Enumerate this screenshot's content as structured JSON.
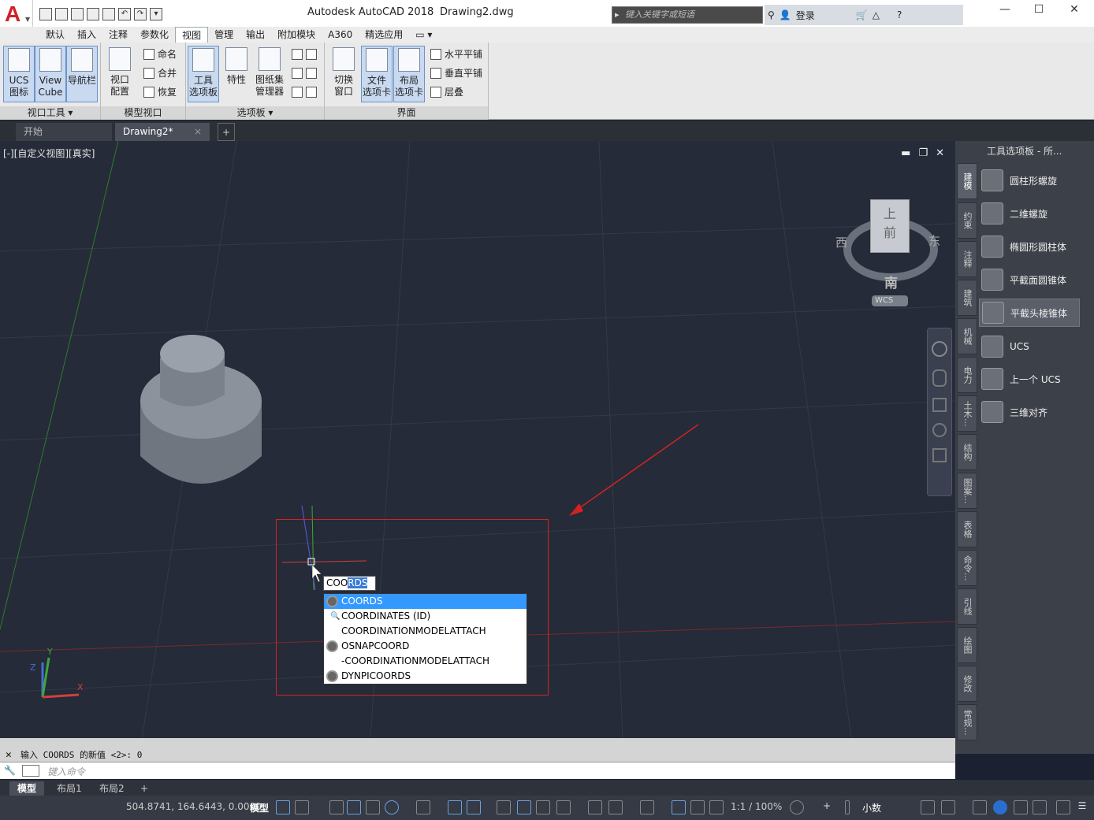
{
  "title": {
    "app": "Autodesk AutoCAD 2018",
    "doc": "Drawing2.dwg",
    "search_placeholder": "键入关键字或短语",
    "login": "登录"
  },
  "menu": [
    "默认",
    "插入",
    "注释",
    "参数化",
    "视图",
    "管理",
    "输出",
    "附加模块",
    "A360",
    "精选应用"
  ],
  "active_menu": "视图",
  "ribbon": {
    "panels": [
      "视口工具 ▾",
      "模型视口",
      "选项板 ▾",
      "界面"
    ],
    "buttons": {
      "ucs1": "UCS",
      "ucs2": "图标",
      "cube1": "View",
      "cube2": "Cube",
      "nav": "导航栏",
      "vp1": "视口",
      "vp2": "配置",
      "named": "命名",
      "join": "合并",
      "restore": "恢复",
      "tp1": "工具",
      "tp2": "选项板",
      "props": "特性",
      "ss1": "图纸集",
      "ss2": "管理器",
      "sw1": "切换",
      "sw2": "窗口",
      "ft1": "文件",
      "ft2": "选项卡",
      "lt1": "布局",
      "lt2": "选项卡",
      "tileh": "水平平铺",
      "tilev": "垂直平铺",
      "cascade": "层叠"
    }
  },
  "filetabs": [
    "开始",
    "Drawing2*"
  ],
  "viewport": {
    "label": "[-][自定义视图][真实]",
    "viewcube": {
      "top": "上",
      "front": "前",
      "west": "西",
      "east": "东",
      "south": "南",
      "wcs": "WCS"
    },
    "axes": {
      "x": "X",
      "y": "Y",
      "z": "Z"
    }
  },
  "command": {
    "typed": "COO",
    "suggested": "RDS"
  },
  "autocomplete": [
    {
      "label": "COORDS",
      "icon": "gear-icon",
      "highlighted": true
    },
    {
      "label": "COORDINATES (ID)",
      "icon": "magnifier-icon"
    },
    {
      "label": "COORDINATIONMODELATTACH",
      "icon": "none"
    },
    {
      "label": "OSNAPCOORD",
      "icon": "gear-icon"
    },
    {
      "label": "-COORDINATIONMODELATTACH",
      "icon": "none"
    },
    {
      "label": "DYNPICOORDS",
      "icon": "gear-icon"
    }
  ],
  "palette": {
    "title": "工具选项板 - 所...",
    "tabs": [
      "建模",
      "约束",
      "注释",
      "建筑",
      "机械",
      "电力",
      "土木...",
      "结构",
      "图案...",
      "表格",
      "命令...",
      "引线",
      "绘图",
      "修改",
      "常规..."
    ],
    "items": [
      "圆柱形螺旋",
      "二维螺旋",
      "椭圆形圆柱体",
      "平截面圆锥体",
      "平截头棱锥体",
      "UCS",
      "上一个 UCS",
      "三维对齐"
    ],
    "selected": "平截头棱锥体"
  },
  "history": "输入 COORDS 的新值 <2>: 0",
  "cmd_placeholder": "键入命令",
  "layout_tabs": [
    "模型",
    "布局1",
    "布局2"
  ],
  "status": {
    "coords": "504.8741, 164.6443, 0.0000",
    "model": "模型",
    "scale": "1:1 / 100%",
    "units": "小数"
  },
  "colors": {
    "accent": "#3399ff",
    "annotation": "#d42222",
    "autocad_red": "#d21f26"
  }
}
